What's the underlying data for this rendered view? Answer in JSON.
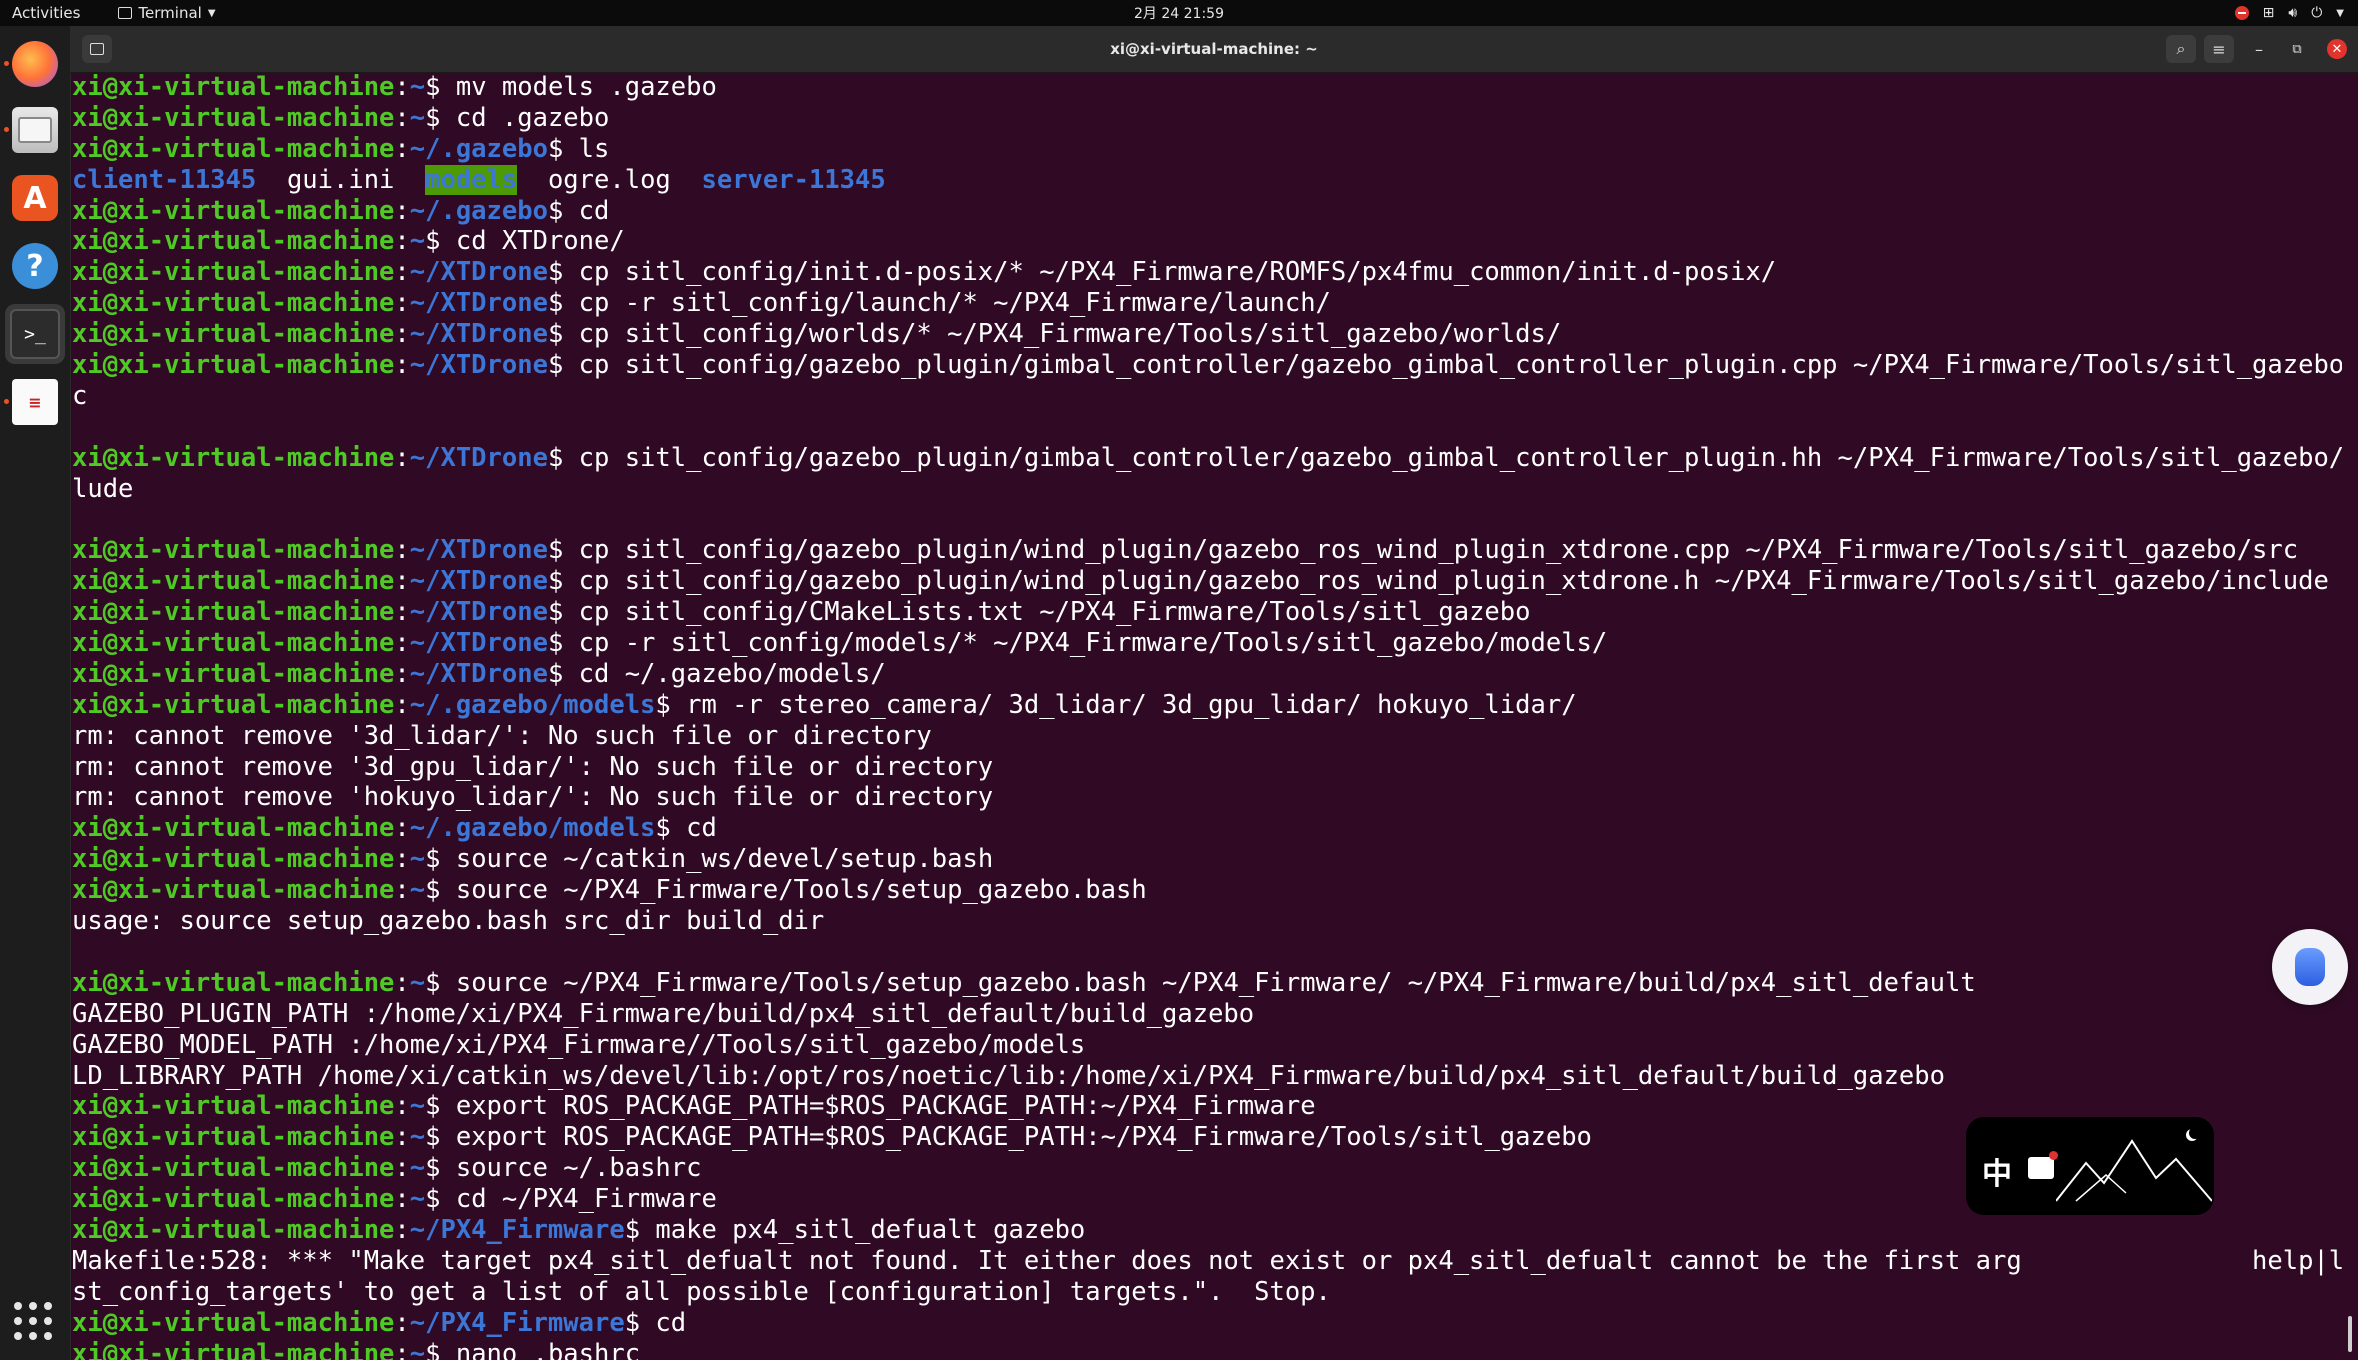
{
  "topbar": {
    "activities": "Activities",
    "app_menu": "Terminal",
    "clock": "2月 24  21:59"
  },
  "window": {
    "title": "xi@xi-virtual-machine: ~"
  },
  "ime": {
    "label": "中"
  },
  "terminal": {
    "user_host": "xi@xi-virtual-machine",
    "lines": [
      {
        "type": "prompt",
        "path": "~",
        "cmd": " mv models .gazebo"
      },
      {
        "type": "prompt",
        "path": "~",
        "cmd": " cd .gazebo"
      },
      {
        "type": "prompt",
        "path": "~/.gazebo",
        "cmd": " ls"
      },
      {
        "type": "ls",
        "items": [
          {
            "text": "client-11345",
            "style": "dir"
          },
          {
            "text": "  gui.ini  ",
            "style": "plain"
          },
          {
            "text": "models",
            "style": "hl"
          },
          {
            "text": "  ogre.log  ",
            "style": "plain"
          },
          {
            "text": "server-11345",
            "style": "dir"
          }
        ]
      },
      {
        "type": "prompt",
        "path": "~/.gazebo",
        "cmd": " cd"
      },
      {
        "type": "prompt",
        "path": "~",
        "cmd": " cd XTDrone/"
      },
      {
        "type": "prompt",
        "path": "~/XTDrone",
        "cmd": " cp sitl_config/init.d-posix/* ~/PX4_Firmware/ROMFS/px4fmu_common/init.d-posix/"
      },
      {
        "type": "prompt",
        "path": "~/XTDrone",
        "cmd": " cp -r sitl_config/launch/* ~/PX4_Firmware/launch/"
      },
      {
        "type": "prompt",
        "path": "~/XTDrone",
        "cmd": " cp sitl_config/worlds/* ~/PX4_Firmware/Tools/sitl_gazebo/worlds/"
      },
      {
        "type": "prompt",
        "path": "~/XTDrone",
        "cmd": " cp sitl_config/gazebo_plugin/gimbal_controller/gazebo_gimbal_controller_plugin.cpp ~/PX4_Firmware/Tools/sitl_gazebo/sr"
      },
      {
        "type": "output",
        "text": "c"
      },
      {
        "type": "output",
        "text": ""
      },
      {
        "type": "prompt",
        "path": "~/XTDrone",
        "cmd": " cp sitl_config/gazebo_plugin/gimbal_controller/gazebo_gimbal_controller_plugin.hh ~/PX4_Firmware/Tools/sitl_gazebo/inc"
      },
      {
        "type": "output",
        "text": "lude"
      },
      {
        "type": "output",
        "text": ""
      },
      {
        "type": "prompt",
        "path": "~/XTDrone",
        "cmd": " cp sitl_config/gazebo_plugin/wind_plugin/gazebo_ros_wind_plugin_xtdrone.cpp ~/PX4_Firmware/Tools/sitl_gazebo/src"
      },
      {
        "type": "prompt",
        "path": "~/XTDrone",
        "cmd": " cp sitl_config/gazebo_plugin/wind_plugin/gazebo_ros_wind_plugin_xtdrone.h ~/PX4_Firmware/Tools/sitl_gazebo/include"
      },
      {
        "type": "prompt",
        "path": "~/XTDrone",
        "cmd": " cp sitl_config/CMakeLists.txt ~/PX4_Firmware/Tools/sitl_gazebo"
      },
      {
        "type": "prompt",
        "path": "~/XTDrone",
        "cmd": " cp -r sitl_config/models/* ~/PX4_Firmware/Tools/sitl_gazebo/models/"
      },
      {
        "type": "prompt",
        "path": "~/XTDrone",
        "cmd": " cd ~/.gazebo/models/"
      },
      {
        "type": "prompt",
        "path": "~/.gazebo/models",
        "cmd": " rm -r stereo_camera/ 3d_lidar/ 3d_gpu_lidar/ hokuyo_lidar/"
      },
      {
        "type": "output",
        "text": "rm: cannot remove '3d_lidar/': No such file or directory"
      },
      {
        "type": "output",
        "text": "rm: cannot remove '3d_gpu_lidar/': No such file or directory"
      },
      {
        "type": "output",
        "text": "rm: cannot remove 'hokuyo_lidar/': No such file or directory"
      },
      {
        "type": "prompt",
        "path": "~/.gazebo/models",
        "cmd": " cd"
      },
      {
        "type": "prompt",
        "path": "~",
        "cmd": " source ~/catkin_ws/devel/setup.bash"
      },
      {
        "type": "prompt",
        "path": "~",
        "cmd": " source ~/PX4_Firmware/Tools/setup_gazebo.bash"
      },
      {
        "type": "output",
        "text": "usage: source setup_gazebo.bash src_dir build_dir"
      },
      {
        "type": "output",
        "text": ""
      },
      {
        "type": "prompt",
        "path": "~",
        "cmd": " source ~/PX4_Firmware/Tools/setup_gazebo.bash ~/PX4_Firmware/ ~/PX4_Firmware/build/px4_sitl_default"
      },
      {
        "type": "output",
        "text": "GAZEBO_PLUGIN_PATH :/home/xi/PX4_Firmware/build/px4_sitl_default/build_gazebo"
      },
      {
        "type": "output",
        "text": "GAZEBO_MODEL_PATH :/home/xi/PX4_Firmware//Tools/sitl_gazebo/models"
      },
      {
        "type": "output",
        "text": "LD_LIBRARY_PATH /home/xi/catkin_ws/devel/lib:/opt/ros/noetic/lib:/home/xi/PX4_Firmware/build/px4_sitl_default/build_gazebo"
      },
      {
        "type": "prompt",
        "path": "~",
        "cmd": " export ROS_PACKAGE_PATH=$ROS_PACKAGE_PATH:~/PX4_Firmware"
      },
      {
        "type": "prompt",
        "path": "~",
        "cmd": " export ROS_PACKAGE_PATH=$ROS_PACKAGE_PATH:~/PX4_Firmware/Tools/sitl_gazebo"
      },
      {
        "type": "prompt",
        "path": "~",
        "cmd": " source ~/.bashrc"
      },
      {
        "type": "prompt",
        "path": "~",
        "cmd": " cd ~/PX4_Firmware"
      },
      {
        "type": "prompt",
        "path": "~/PX4_Firmware",
        "cmd": " make px4_sitl_defualt gazebo"
      },
      {
        "type": "output",
        "text": "Makefile:528: *** \"Make target px4_sitl_defualt not found. It either does not exist or px4_sitl_defualt cannot be the first arg               help|li"
      },
      {
        "type": "output",
        "text": "st_config_targets' to get a list of all possible [configuration] targets.\".  Stop."
      },
      {
        "type": "prompt",
        "path": "~/PX4_Firmware",
        "cmd": " cd"
      },
      {
        "type": "prompt",
        "path": "~",
        "cmd": " nano .bashrc"
      },
      {
        "type": "prompt",
        "path": "~",
        "cmd": " ",
        "cursor": true
      }
    ]
  }
}
